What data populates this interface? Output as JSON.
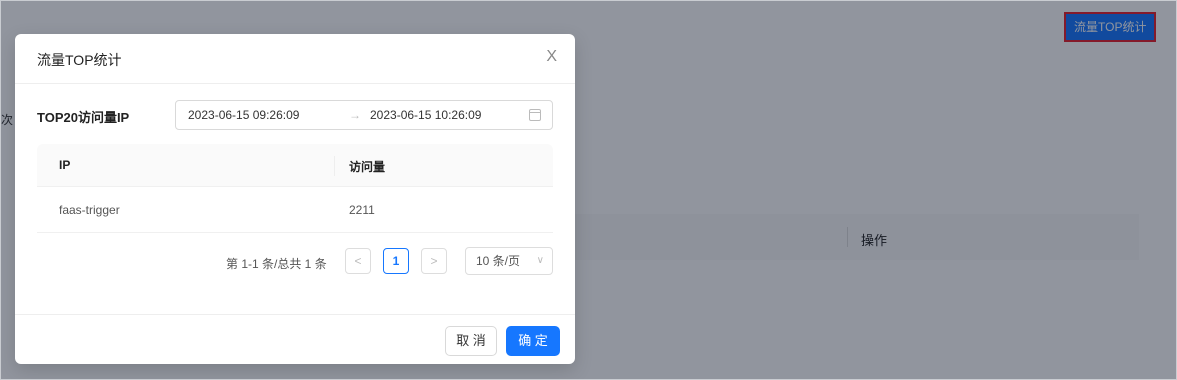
{
  "top_button_label": "流量TOP统计",
  "background": {
    "side_char": "次",
    "op_header": "操作"
  },
  "modal": {
    "title": "流量TOP统计",
    "close": "X",
    "range_label": "TOP20访问量IP",
    "range_start": "2023-06-15 09:26:09",
    "range_arrow": "→",
    "range_end": "2023-06-15 10:26:09",
    "columns": [
      "IP",
      "访问量"
    ],
    "rows": [
      {
        "ip": "faas-trigger",
        "count": "2211"
      }
    ],
    "pagination": {
      "total": "第 1-1 条/总共 1 条",
      "prev": "<",
      "page": "1",
      "next": ">",
      "page_size": "10 条/页"
    },
    "cancel_label": "取 消",
    "ok_label": "确 定"
  }
}
